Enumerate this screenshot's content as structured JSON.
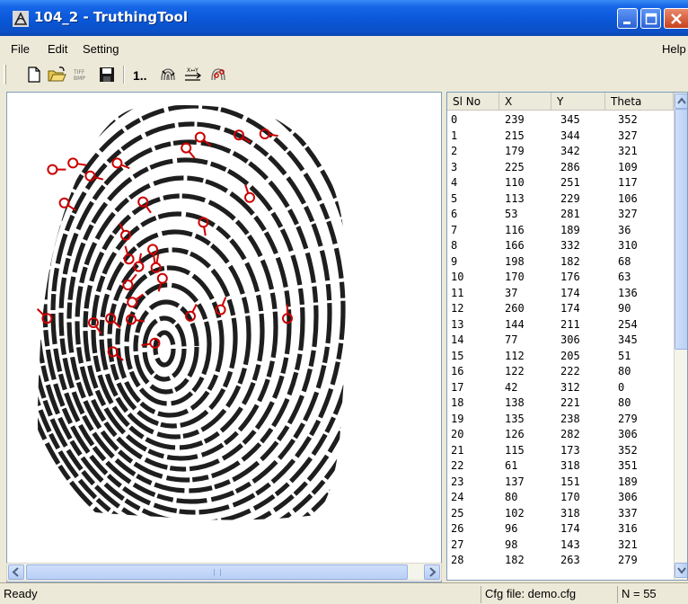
{
  "window": {
    "title": "104_2 - TruthingTool"
  },
  "menu": {
    "file": "File",
    "edit": "Edit",
    "setting": "Setting",
    "help": "Help"
  },
  "toolbar": {
    "numbers_label": "1..",
    "icons": [
      "new-file-icon",
      "open-folder-icon",
      "tiff-bmp-icon",
      "save-icon",
      "fingerprint-icon",
      "swap-xy-icon",
      "fingerprint-minutiae-icon"
    ]
  },
  "image": {
    "subject": "fingerprint",
    "marker_color": "#cc0000"
  },
  "list": {
    "columns": [
      "Sl No",
      "X",
      "Y",
      "Theta"
    ],
    "rows": [
      [
        "0",
        "239",
        "345",
        "352"
      ],
      [
        "1",
        "215",
        "344",
        "327"
      ],
      [
        "2",
        "179",
        "342",
        "321"
      ],
      [
        "3",
        "225",
        "286",
        "109"
      ],
      [
        "4",
        "110",
        "251",
        "117"
      ],
      [
        "5",
        "113",
        "229",
        "106"
      ],
      [
        "6",
        "53",
        "281",
        "327"
      ],
      [
        "7",
        "116",
        "189",
        "36"
      ],
      [
        "8",
        "166",
        "332",
        "310"
      ],
      [
        "9",
        "198",
        "182",
        "68"
      ],
      [
        "10",
        "170",
        "176",
        "63"
      ],
      [
        "11",
        "37",
        "174",
        "136"
      ],
      [
        "12",
        "260",
        "174",
        "90"
      ],
      [
        "13",
        "144",
        "211",
        "254"
      ],
      [
        "14",
        "77",
        "306",
        "345"
      ],
      [
        "15",
        "112",
        "205",
        "51"
      ],
      [
        "16",
        "122",
        "222",
        "80"
      ],
      [
        "17",
        "42",
        "312",
        "0"
      ],
      [
        "18",
        "138",
        "221",
        "80"
      ],
      [
        "19",
        "135",
        "238",
        "279"
      ],
      [
        "20",
        "126",
        "282",
        "306"
      ],
      [
        "21",
        "115",
        "173",
        "352"
      ],
      [
        "22",
        "61",
        "318",
        "351"
      ],
      [
        "23",
        "137",
        "151",
        "189"
      ],
      [
        "24",
        "80",
        "170",
        "306"
      ],
      [
        "25",
        "102",
        "318",
        "337"
      ],
      [
        "26",
        "96",
        "174",
        "316"
      ],
      [
        "27",
        "98",
        "143",
        "321"
      ],
      [
        "28",
        "182",
        "263",
        "279"
      ]
    ]
  },
  "statusbar": {
    "status": "Ready",
    "cfg_file": "Cfg file: demo.cfg",
    "count": "N =  55"
  }
}
